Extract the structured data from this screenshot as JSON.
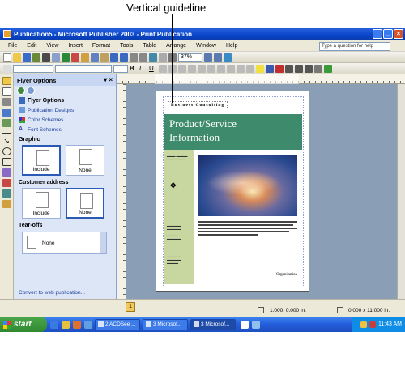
{
  "callout": {
    "text": "Vertical guideline"
  },
  "window": {
    "title": "Publication5 - Microsoft Publisher 2003 - Print Publication"
  },
  "menu": [
    "File",
    "Edit",
    "View",
    "Insert",
    "Format",
    "Tools",
    "Table",
    "Arrange",
    "Window",
    "Help"
  ],
  "help_placeholder": "Type a question for help",
  "toolbar": {
    "zoom": "37%"
  },
  "taskpane": {
    "title": "Flyer Options",
    "links": [
      {
        "label": "Flyer Options",
        "active": true
      },
      {
        "label": "Publication Designs",
        "active": false
      },
      {
        "label": "Color Schemes",
        "active": false
      },
      {
        "label": "Font Schemes",
        "active": false
      }
    ],
    "graphic": {
      "heading": "Graphic",
      "options": [
        "Include",
        "None"
      ],
      "selected": "Include"
    },
    "customer_address": {
      "heading": "Customer address",
      "options": [
        "Include",
        "None"
      ],
      "selected": "None"
    },
    "tearoffs": {
      "heading": "Tear-offs",
      "value": "None"
    },
    "convert_link": "Convert to web publication..."
  },
  "document": {
    "company": "Business Consulting",
    "headline_1": "Product/Service",
    "headline_2": "Information",
    "organization": "Organization"
  },
  "status": {
    "page": "1",
    "position": "1.000, 0.000 in.",
    "size": "0.000 x 11.000 in."
  },
  "taskbar": {
    "start": "start",
    "tasks": [
      "2 ACDSee ...",
      "3 Microsof...",
      "3 Microsof..."
    ],
    "clock": "11:43 AM"
  }
}
